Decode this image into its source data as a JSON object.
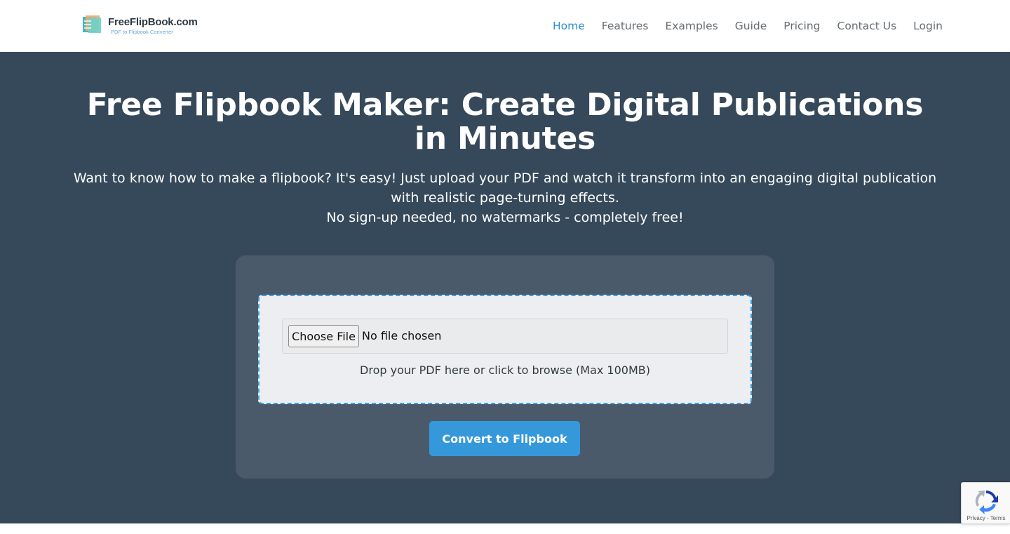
{
  "header": {
    "logo_title": "FreeFlipBook.com",
    "logo_subtitle": "PDF to Flipbook Converter",
    "nav": [
      {
        "label": "Home",
        "active": true
      },
      {
        "label": "Features",
        "active": false
      },
      {
        "label": "Examples",
        "active": false
      },
      {
        "label": "Guide",
        "active": false
      },
      {
        "label": "Pricing",
        "active": false
      },
      {
        "label": "Contact Us",
        "active": false
      },
      {
        "label": "Login",
        "active": false
      }
    ]
  },
  "hero": {
    "title": "Free Flipbook Maker: Create Digital Publications in Minutes",
    "description": "Want to know how to make a flipbook? It's easy! Just upload your PDF and watch it transform into an engaging digital publication with realistic page-turning effects.",
    "note": "No sign-up needed, no watermarks - completely free!"
  },
  "upload": {
    "choose_label": "Choose File",
    "file_status": "No file chosen",
    "hint": "Drop your PDF here or click to browse (Max 100MB)",
    "convert_label": "Convert to Flipbook"
  },
  "recaptcha": {
    "terms": "Privacy - Terms"
  },
  "colors": {
    "hero_bg": "#36495a",
    "card_bg": "#4a5a6a",
    "accent": "#3498db",
    "nav_active": "#2b8fd4"
  },
  "icons": [
    "flipbook-logo-icon",
    "recaptcha-icon"
  ]
}
